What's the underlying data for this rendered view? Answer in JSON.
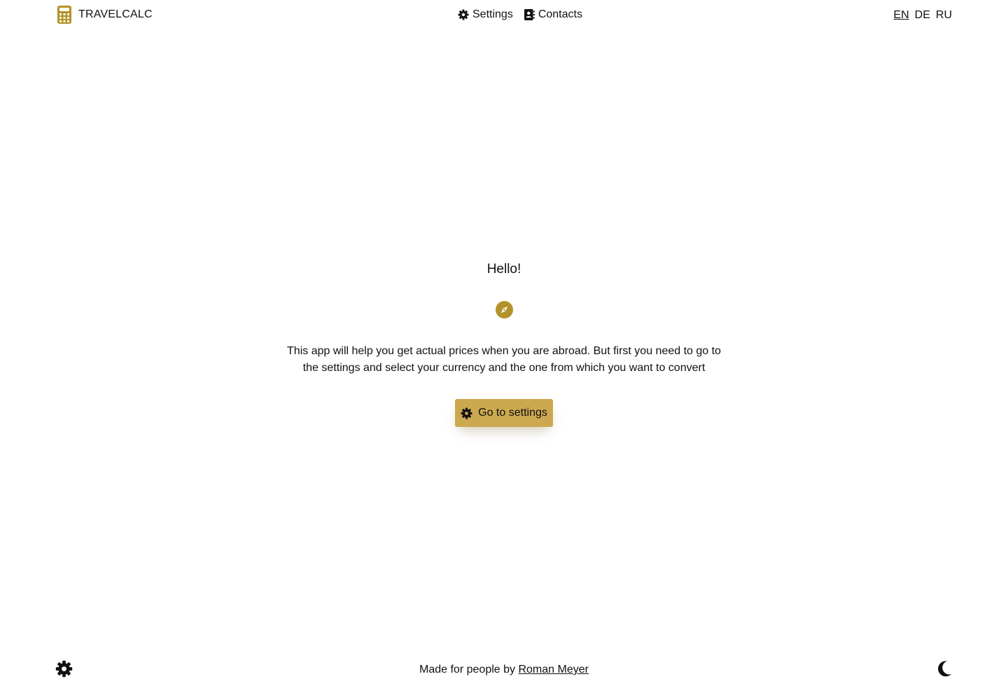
{
  "app": {
    "name": "TRAVELCALC",
    "brand_icon": "calculator-icon",
    "accent_color": "#cca850",
    "icon_color": "#b39329"
  },
  "nav": {
    "settings": {
      "label": "Settings",
      "icon": "gear-icon"
    },
    "contacts": {
      "label": "Contacts",
      "icon": "address-book-icon"
    }
  },
  "languages": {
    "options": [
      "EN",
      "DE",
      "RU"
    ],
    "active": "EN"
  },
  "main": {
    "greeting": "Hello!",
    "icon": "compass-icon",
    "description": "This app will help you get actual prices when you are abroad. But first you need to go to the settings and select your currency and the one from which you want to convert",
    "cta": {
      "label": "Go to settings",
      "icon": "gear-icon"
    }
  },
  "footer": {
    "credit_prefix": "Made for people by ",
    "author": "Roman Meyer",
    "left_icon": "gear-icon",
    "right_icon": "moon-icon"
  }
}
